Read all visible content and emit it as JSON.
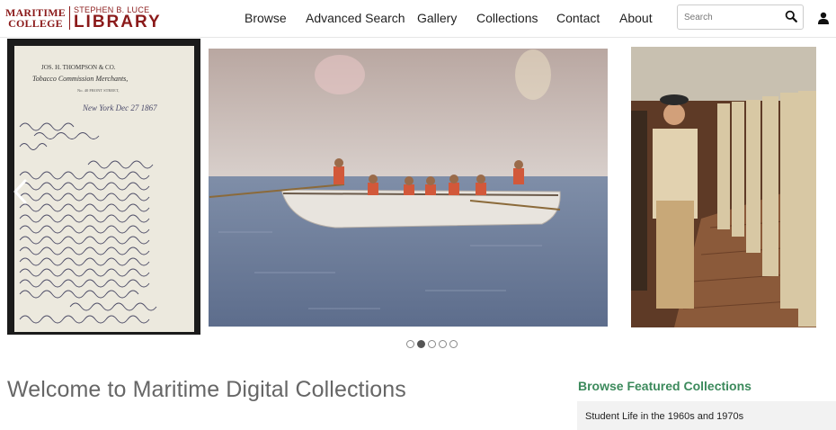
{
  "logo": {
    "left_line1": "MARITIME",
    "left_line2": "COLLEGE",
    "right_line1": "STEPHEN B. LUCE",
    "right_line2": "LIBRARY"
  },
  "nav": {
    "items": [
      {
        "label": "Browse"
      },
      {
        "label": "Advanced Search"
      },
      {
        "label": "Gallery"
      },
      {
        "label": "Collections"
      },
      {
        "label": "Contact"
      },
      {
        "label": "About"
      }
    ]
  },
  "search": {
    "placeholder": "Search",
    "icon": "search-icon"
  },
  "user": {
    "icon": "user-icon"
  },
  "carousel": {
    "slides": [
      {
        "name": "handwritten-letter"
      },
      {
        "name": "rowing-boat-photo"
      },
      {
        "name": "cadet-inspection-photo"
      }
    ],
    "letter_heading": "JOS. H. THOMPSON & CO.",
    "letter_subheading": "Tobacco Commission Merchants,",
    "letter_street": "No. 40 FRONT STREET,",
    "letter_place": "New York Dec 27 1867",
    "dots": {
      "count": 5,
      "active_index": 1
    },
    "prev_icon": "chevron-left-icon",
    "next_icon": "chevron-right-icon"
  },
  "main": {
    "welcome": "Welcome to Maritime Digital Collections"
  },
  "featured": {
    "title": "Browse Featured Collections",
    "items": [
      "Student Life in the 1960s and 1970s"
    ]
  }
}
